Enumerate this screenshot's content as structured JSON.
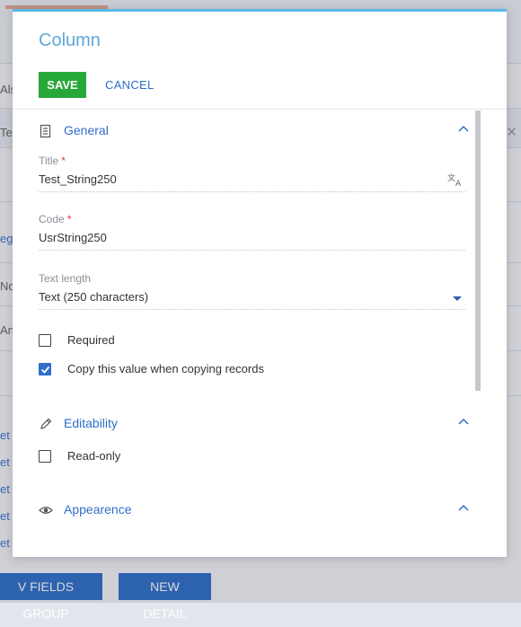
{
  "background": {
    "fragments": [
      "Als",
      "Te",
      "eg",
      "No",
      "An",
      "et",
      "et",
      "et",
      "et",
      "et"
    ],
    "bottom_buttons": [
      "V FIELDS GROUP",
      "NEW DETAIL"
    ]
  },
  "modal": {
    "title": "Column",
    "save_label": "SAVE",
    "cancel_label": "CANCEL",
    "sections": {
      "general": {
        "title": "General"
      },
      "editability": {
        "title": "Editability"
      },
      "appearance": {
        "title": "Appearence"
      }
    },
    "fields": {
      "title": {
        "label": "Title",
        "required_mark": "*",
        "value": "Test_String250"
      },
      "code": {
        "label": "Code",
        "required_mark": "*",
        "value": "UsrString250"
      },
      "text_length": {
        "label": "Text length",
        "value": "Text (250 characters)"
      }
    },
    "checkboxes": {
      "required": {
        "label": "Required",
        "checked": false
      },
      "copy_value": {
        "label": "Copy this value when copying records",
        "checked": true
      },
      "read_only": {
        "label": "Read-only",
        "checked": false
      }
    }
  },
  "colors": {
    "accent": "#2f6ec9",
    "save": "#28a83a",
    "title": "#60a7d9",
    "required": "#e0393e"
  }
}
